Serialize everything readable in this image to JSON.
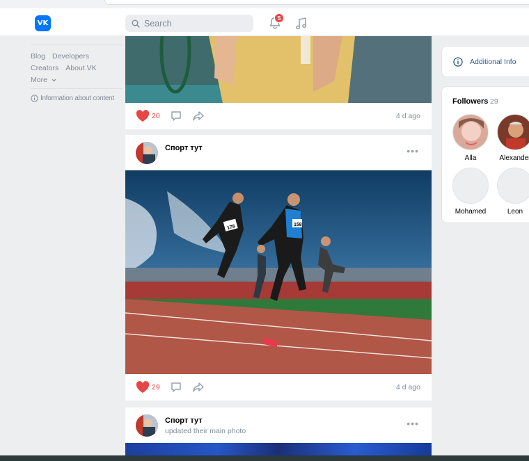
{
  "header": {
    "logo_text": "VK",
    "search_placeholder": "Search",
    "notifications_count": "5"
  },
  "left_nav": {
    "row1": [
      "Blog",
      "Developers"
    ],
    "row2": [
      "Creators",
      "About VK"
    ],
    "more_label": "More",
    "info_label": "Information about content"
  },
  "feed": {
    "post1": {
      "likes": "20",
      "time": "4 d ago"
    },
    "post2": {
      "author": "Спорт тут",
      "likes": "29",
      "time": "4 d ago",
      "bib_labels": [
        "178",
        "158"
      ]
    },
    "post3": {
      "author": "Спорт тут",
      "subtitle": "updated their main photo"
    }
  },
  "right": {
    "additional_info": "Additional Info",
    "followers_title": "Followers",
    "followers_count": "29",
    "followers": [
      {
        "name": "Alla"
      },
      {
        "name": "Alexander"
      },
      {
        "name": "Mohamed"
      },
      {
        "name": "Leon"
      }
    ]
  },
  "colors": {
    "accent": "#0077ff",
    "like": "#e64646",
    "link": "#2a5885",
    "muted": "#818c99"
  }
}
